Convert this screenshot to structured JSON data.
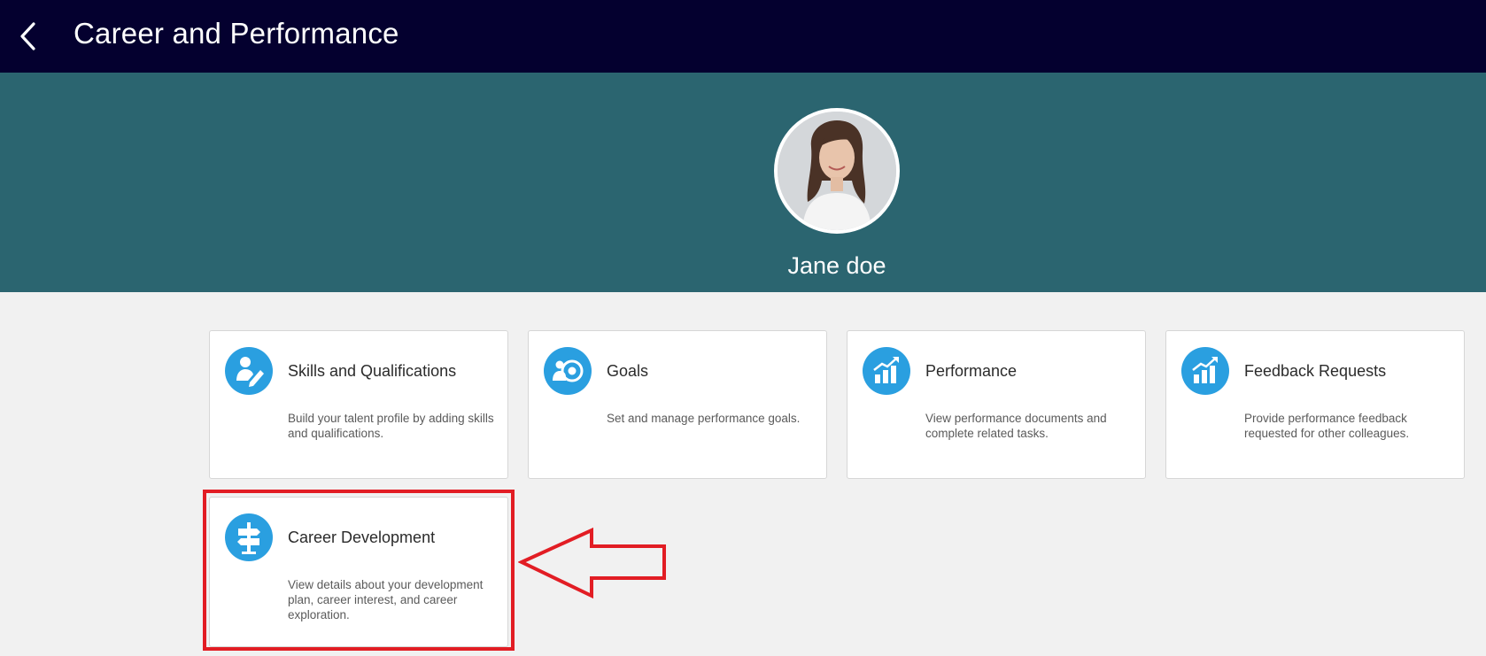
{
  "header": {
    "title": "Career and Performance",
    "back_icon": "chevron-left-icon",
    "background": "#04002f"
  },
  "profile": {
    "name": "Jane doe",
    "banner_color": "#2b6570"
  },
  "cards": [
    {
      "title": "Skills and Qualifications",
      "description": "Build your talent profile by adding skills and qualifications.",
      "icon": "person-edit-icon"
    },
    {
      "title": "Goals",
      "description": "Set and manage performance goals.",
      "icon": "target-icon"
    },
    {
      "title": "Performance",
      "description": "View performance documents and complete related tasks.",
      "icon": "bar-chart-up-icon"
    },
    {
      "title": "Feedback Requests",
      "description": "Provide performance feedback requested for other colleagues.",
      "icon": "bar-chart-up-icon"
    },
    {
      "title": "Career Development",
      "description": "View details about your development plan, career interest, and career exploration.",
      "icon": "signpost-icon"
    }
  ],
  "colors": {
    "icon_accent": "#2a9fe0",
    "highlight": "#e21d24"
  }
}
